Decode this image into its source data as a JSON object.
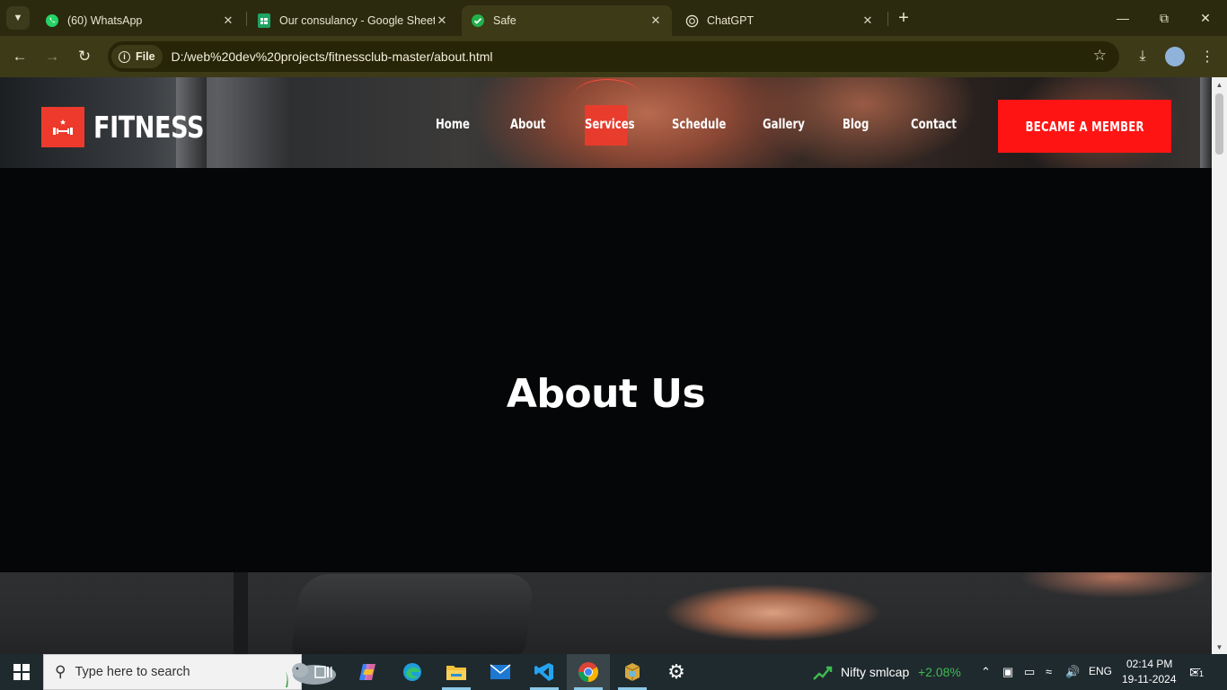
{
  "browser": {
    "tabs": [
      {
        "title": "(60) WhatsApp",
        "active": false
      },
      {
        "title": "Our consulancy - Google Sheets",
        "active": false
      },
      {
        "title": "Safe",
        "active": true
      },
      {
        "title": "ChatGPT",
        "active": false
      }
    ],
    "address_chip": "File",
    "url": "D:/web%20dev%20projects/fitnessclub-master/about.html"
  },
  "site": {
    "logo_text": "FITNESS",
    "nav": [
      "Home",
      "About",
      "Services",
      "Schedule",
      "Gallery",
      "Blog",
      "Contact"
    ],
    "cta_label": "BECAME A MEMBER",
    "page_title": "About Us",
    "colors": {
      "accent": "#ee3a2c",
      "cta": "#ff1414",
      "band": "#050607"
    }
  },
  "taskbar": {
    "search_placeholder": "Type here to search",
    "stock_name": "Nifty smlcap",
    "stock_change": "+2.08%",
    "language": "ENG",
    "time": "02:14 PM",
    "date": "19-11-2024",
    "notification_count": "1"
  }
}
